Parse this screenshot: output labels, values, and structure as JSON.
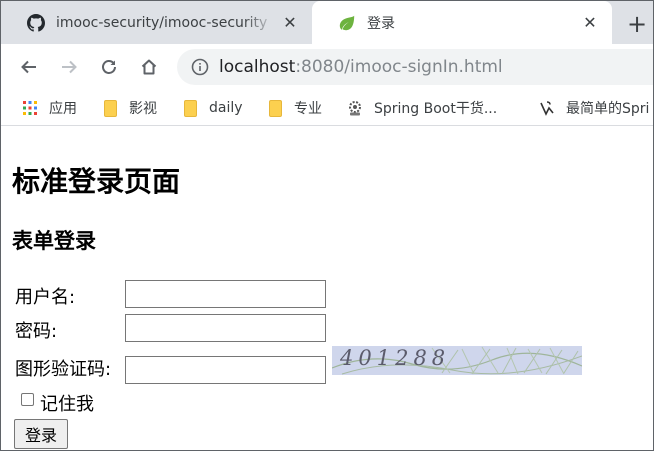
{
  "browser": {
    "tabs": [
      {
        "title": "imooc-security/imooc-security",
        "icon": "github-icon",
        "active": false
      },
      {
        "title": "登录",
        "icon": "spring-leaf-icon",
        "active": true
      }
    ],
    "new_tab_icon": "plus-icon",
    "close_icon": "close-icon",
    "url_host": "localhost",
    "url_rest": ":8080/imooc-signIn.html",
    "bookmarks": [
      {
        "label": "应用",
        "icon": "apps-grid-icon"
      },
      {
        "label": "影视",
        "icon": "folder-icon"
      },
      {
        "label": "daily",
        "icon": "folder-icon"
      },
      {
        "label": "专业",
        "icon": "folder-icon"
      },
      {
        "label": "Spring Boot干货...",
        "icon": "gear-site-icon"
      },
      {
        "label": "最简单的Spri",
        "icon": "site-logo-icon"
      }
    ]
  },
  "page": {
    "title": "标准登录页面",
    "form_title": "表单登录",
    "username_label": "用户名:",
    "username_value": "",
    "password_label": "密码:",
    "password_value": "",
    "captcha_label": "图形验证码:",
    "captcha_value": "",
    "captcha_code": "401288",
    "remember_label": "记住我",
    "remember_checked": false,
    "submit_label": "登录"
  },
  "colors": {
    "tabstrip": "#dee1e6",
    "omnibox": "#f1f3f4",
    "folder": "#fcd04f",
    "captcha_bg": "#cfd6ec"
  }
}
